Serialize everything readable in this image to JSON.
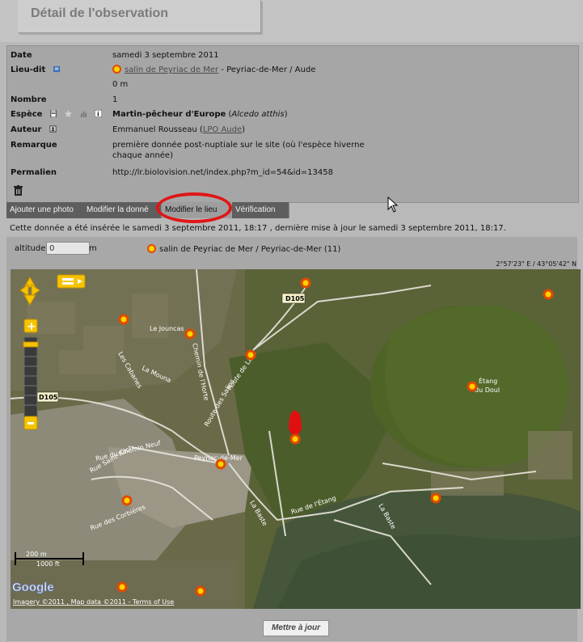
{
  "page": {
    "title": "Détail de l'observation"
  },
  "details": {
    "date": {
      "label": "Date",
      "value": "samedi 3 septembre 2011"
    },
    "lieu_dit": {
      "label": "Lieu-dit",
      "link": "salin de Peyriac de Mer",
      "suffix": " - Peyriac-de-Mer / Aude",
      "distance": "0 m"
    },
    "nombre": {
      "label": "Nombre",
      "value": "1"
    },
    "espece": {
      "label": "Espèce",
      "name": "Martin-pêcheur d'Europe",
      "latin": "Alcedo atthis"
    },
    "auteur": {
      "label": "Auteur",
      "name": "Emmanuel Rousseau",
      "org": "LPO Aude"
    },
    "remarque": {
      "label": "Remarque",
      "value": "première donnée post-nuptiale sur le site (où l'espèce hiverne chaque année)"
    },
    "permalien": {
      "label": "Permalien",
      "value": "http://lr.biolovision.net/index.php?m_id=54&id=13458"
    }
  },
  "tabs": [
    {
      "label": "Ajouter une photo"
    },
    {
      "label": "Modifier la donné"
    },
    {
      "label": "Modifier le lieu"
    },
    {
      "label": "Vérification"
    }
  ],
  "status_line": "Cette donnée a été insérée le samedi 3 septembre 2011, 18:17 , dernière mise à jour le samedi 3 septembre 2011, 18:17.",
  "altitude": {
    "label": "altitude",
    "value": "0",
    "unit": "m"
  },
  "place": "salin de Peyriac de Mer / Peyriac-de-Mer (11)",
  "map": {
    "coords": "2°57'23\" E / 43°05'42\" N",
    "labels": {
      "d105_top": "D105",
      "d105_left": "D105",
      "le_jouncas": "Le Jouncas",
      "etang": "Étang",
      "du_doul": "du Doul",
      "peyriac": "Peyriac-de-Mer",
      "rue_chemin_neuf": "Rue du Chemin Neuf",
      "rue_saint_roch": "Rue Saint-Roch",
      "rue_etang": "Rue de l'Étang",
      "la_baste": "La Baste",
      "la_baste2": "La Baste",
      "rue_corbieres": "Rue des Corbières",
      "la_mouna": "La Mouna",
      "chemin_horte": "Chemin de l'Horte",
      "route_salins": "Route des Salins",
      "route_lacs": "Route de Lacs",
      "les_cabanes": "Les Cabanes"
    },
    "scale_m": "200 m",
    "scale_ft": "1000 ft",
    "google": "Google",
    "attribution": "Imagery ©2011 , Map data ©2011 - Terms of Use"
  },
  "buttons": {
    "update": "Mettre à jour"
  },
  "colors": {
    "accent_red": "#e01616",
    "marker_fill": "#ffd200",
    "marker_stroke": "#e04a00",
    "tab_bg": "#5e5e5e"
  }
}
